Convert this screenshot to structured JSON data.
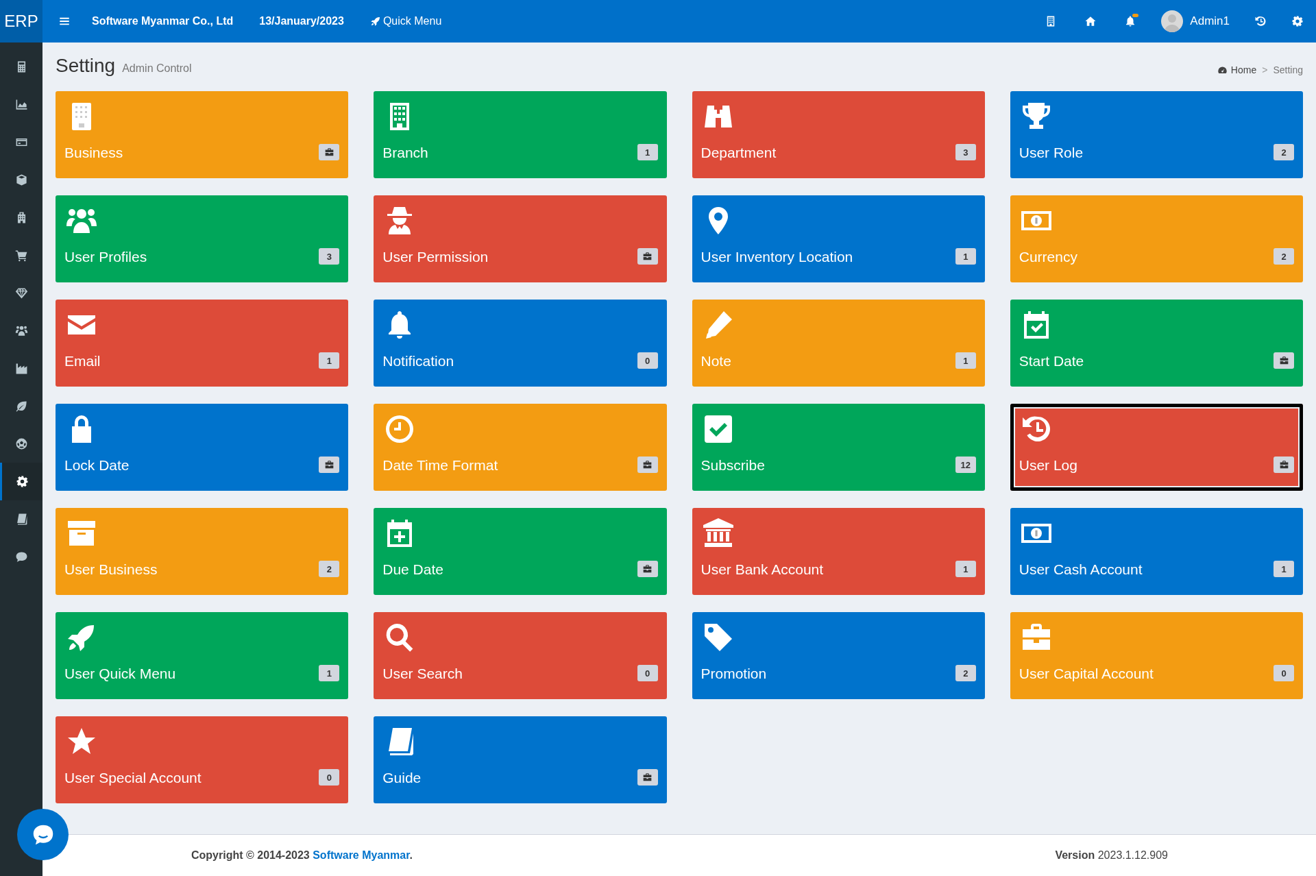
{
  "topbar": {
    "logo": "ERP",
    "company": "Software Myanmar Co., Ltd",
    "date": "13/January/2023",
    "quick_menu": "Quick Menu",
    "notifications_unread": true,
    "user": "Admin1"
  },
  "sidebar": {
    "items": [
      {
        "kind": "calculator",
        "selected": false
      },
      {
        "kind": "area-chart",
        "selected": false
      },
      {
        "kind": "card",
        "selected": false
      },
      {
        "kind": "cube",
        "selected": false
      },
      {
        "kind": "hospital",
        "selected": false
      },
      {
        "kind": "cart",
        "selected": false
      },
      {
        "kind": "diamond",
        "selected": false
      },
      {
        "kind": "users",
        "selected": false
      },
      {
        "kind": "factory",
        "selected": false
      },
      {
        "kind": "leaf",
        "selected": false
      },
      {
        "kind": "ball",
        "selected": false
      },
      {
        "kind": "gear",
        "selected": true
      },
      {
        "kind": "book",
        "selected": false
      },
      {
        "kind": "comment",
        "selected": false
      }
    ]
  },
  "page_header": {
    "title": "Setting",
    "subtitle": "Admin Control",
    "breadcrumb": [
      "Home",
      "Setting"
    ],
    "separator": ">"
  },
  "tiles": [
    {
      "label": "Business",
      "kind": "building",
      "color": "#f39c12",
      "badge": {
        "kind": "briefcase"
      },
      "selected": false
    },
    {
      "label": "Branch",
      "kind": "office",
      "color": "#00a65a",
      "badge": {
        "kind": "count",
        "text": "1"
      },
      "selected": false
    },
    {
      "label": "Department",
      "kind": "binoculars",
      "color": "#dd4b39",
      "badge": {
        "kind": "count",
        "text": "3"
      },
      "selected": false
    },
    {
      "label": "User Role",
      "kind": "trophy",
      "color": "#0073cc",
      "badge": {
        "kind": "count",
        "text": "2"
      },
      "selected": false
    },
    {
      "label": "User Profiles",
      "kind": "users",
      "color": "#00a65a",
      "badge": {
        "kind": "count",
        "text": "3"
      },
      "selected": false
    },
    {
      "label": "User Permission",
      "kind": "spy",
      "color": "#dd4b39",
      "badge": {
        "kind": "briefcase"
      },
      "selected": false
    },
    {
      "label": "User Inventory Location",
      "kind": "pin",
      "color": "#0073cc",
      "badge": {
        "kind": "count",
        "text": "1"
      },
      "selected": false
    },
    {
      "label": "Currency",
      "kind": "money",
      "color": "#f39c12",
      "badge": {
        "kind": "count",
        "text": "2"
      },
      "selected": false
    },
    {
      "label": "Email",
      "kind": "envelope",
      "color": "#dd4b39",
      "badge": {
        "kind": "count",
        "text": "1"
      },
      "selected": false
    },
    {
      "label": "Notification",
      "kind": "bell",
      "color": "#0073cc",
      "badge": {
        "kind": "count",
        "text": "0"
      },
      "selected": false
    },
    {
      "label": "Note",
      "kind": "pencil",
      "color": "#f39c12",
      "badge": {
        "kind": "count",
        "text": "1"
      },
      "selected": false
    },
    {
      "label": "Start Date",
      "kind": "calendar-check",
      "color": "#00a65a",
      "badge": {
        "kind": "briefcase"
      },
      "selected": false
    },
    {
      "label": "Lock Date",
      "kind": "lock",
      "color": "#0073cc",
      "badge": {
        "kind": "briefcase"
      },
      "selected": false
    },
    {
      "label": "Date Time Format",
      "kind": "clock",
      "color": "#f39c12",
      "badge": {
        "kind": "briefcase"
      },
      "selected": false
    },
    {
      "label": "Subscribe",
      "kind": "check",
      "color": "#00a65a",
      "badge": {
        "kind": "count",
        "text": "12"
      },
      "selected": false
    },
    {
      "label": "User Log",
      "kind": "history",
      "color": "#dd4b39",
      "badge": {
        "kind": "briefcase"
      },
      "selected": true
    },
    {
      "label": "User Business",
      "kind": "archive",
      "color": "#f39c12",
      "badge": {
        "kind": "count",
        "text": "2"
      },
      "selected": false
    },
    {
      "label": "Due Date",
      "kind": "calendar-plus",
      "color": "#00a65a",
      "badge": {
        "kind": "briefcase"
      },
      "selected": false
    },
    {
      "label": "User Bank Account",
      "kind": "bank",
      "color": "#dd4b39",
      "badge": {
        "kind": "count",
        "text": "1"
      },
      "selected": false
    },
    {
      "label": "User Cash Account",
      "kind": "money",
      "color": "#0073cc",
      "badge": {
        "kind": "count",
        "text": "1"
      },
      "selected": false
    },
    {
      "label": "User Quick Menu",
      "kind": "rocket",
      "color": "#00a65a",
      "badge": {
        "kind": "count",
        "text": "1"
      },
      "selected": false
    },
    {
      "label": "User Search",
      "kind": "search",
      "color": "#dd4b39",
      "badge": {
        "kind": "count",
        "text": "0"
      },
      "selected": false
    },
    {
      "label": "Promotion",
      "kind": "tag",
      "color": "#0073cc",
      "badge": {
        "kind": "count",
        "text": "2"
      },
      "selected": false
    },
    {
      "label": "User Capital Account",
      "kind": "briefcase",
      "color": "#f39c12",
      "badge": {
        "kind": "count",
        "text": "0"
      },
      "selected": false
    },
    {
      "label": "User Special Account",
      "kind": "star",
      "color": "#dd4b39",
      "badge": {
        "kind": "count",
        "text": "0"
      },
      "selected": false
    },
    {
      "label": "Guide",
      "kind": "book",
      "color": "#0073cc",
      "badge": {
        "kind": "briefcase"
      },
      "selected": false
    }
  ],
  "footer": {
    "copyright": "Copyright © 2014-2023",
    "link": "Software Myanmar",
    "copyright_end": ".",
    "version": "**Version** 2023.1.12.909"
  }
}
